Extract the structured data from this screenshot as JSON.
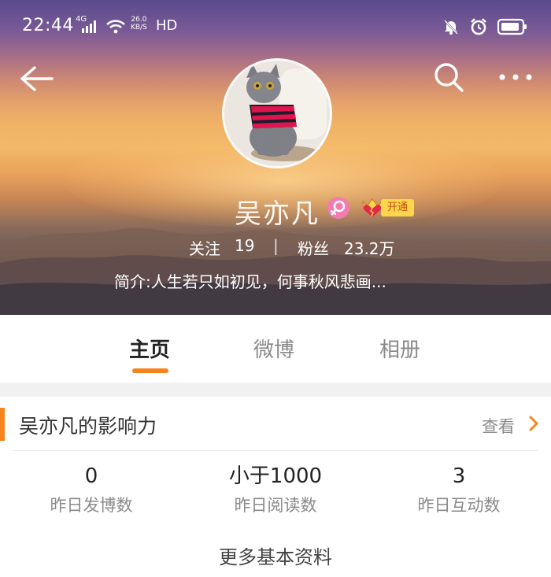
{
  "status_bar": {
    "time": "22:44",
    "network_type": "4G",
    "speed_value": "26.0",
    "speed_unit": "KB/S",
    "hd": "HD",
    "icons": [
      "signal-icon",
      "wifi-icon",
      "mute-icon",
      "alarm-icon",
      "battery-icon"
    ]
  },
  "header": {
    "back_icon": "back-arrow-icon",
    "search_icon": "search-icon",
    "more_icon": "more-icon"
  },
  "profile": {
    "name": "吴亦凡",
    "gender_icon": "female-icon",
    "vip_badge": "开通",
    "follow_label": "关注",
    "follow_count": "19",
    "separator": "|",
    "fans_label": "粉丝",
    "fans_count": "23.2万",
    "bio": "简介:人生若只如初见，何事秋风悲画..."
  },
  "tabs": [
    {
      "label": "主页",
      "active": true
    },
    {
      "label": "微博",
      "active": false
    },
    {
      "label": "相册",
      "active": false
    }
  ],
  "influence": {
    "title": "吴亦凡的影响力",
    "view_label": "查看",
    "metrics": [
      {
        "value": "0",
        "label": "昨日发博数"
      },
      {
        "value": "小于1000",
        "label": "昨日阅读数"
      },
      {
        "value": "3",
        "label": "昨日互动数"
      }
    ],
    "more_info": "更多基本资料"
  },
  "colors": {
    "accent": "#f5841f",
    "female_badge": "#f27bb4",
    "vip_gold": "#fbd54a"
  }
}
